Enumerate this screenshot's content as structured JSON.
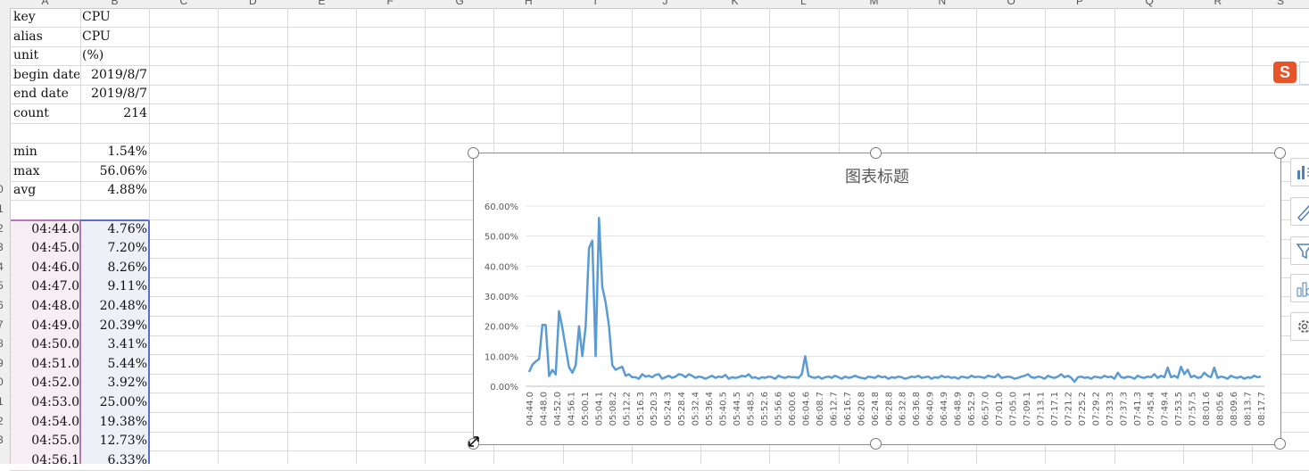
{
  "sheet": {
    "column_letters": [
      "A",
      "B",
      "C",
      "D",
      "E",
      "F",
      "G",
      "H",
      "I",
      "J",
      "K",
      "L",
      "M",
      "N",
      "O",
      "P",
      "Q",
      "R",
      "S"
    ],
    "row_numbers": [
      "",
      "",
      "",
      "",
      "",
      "",
      "",
      "",
      "",
      "0",
      "1",
      "2",
      "3",
      "4",
      "5",
      "6",
      "7",
      "8",
      "9",
      "0",
      "1",
      "2",
      "3",
      ""
    ],
    "info_rows": [
      {
        "label": "key",
        "value": "CPU"
      },
      {
        "label": "alias",
        "value": "CPU"
      },
      {
        "label": "unit",
        "value": "(%)"
      },
      {
        "label": "begin date",
        "value": "2019/8/7"
      },
      {
        "label": "end date",
        "value": "2019/8/7"
      },
      {
        "label": "count",
        "value": "214"
      }
    ],
    "stat_rows": [
      {
        "label": "min",
        "value": "1.54%"
      },
      {
        "label": "max",
        "value": "56.06%"
      },
      {
        "label": "avg",
        "value": "4.88%"
      }
    ],
    "data_rows": [
      {
        "time": "04:44.0",
        "value": "4.76%"
      },
      {
        "time": "04:45.0",
        "value": "7.20%"
      },
      {
        "time": "04:46.0",
        "value": "8.26%"
      },
      {
        "time": "04:47.0",
        "value": "9.11%"
      },
      {
        "time": "04:48.0",
        "value": "20.48%"
      },
      {
        "time": "04:49.0",
        "value": "20.39%"
      },
      {
        "time": "04:50.0",
        "value": "3.41%"
      },
      {
        "time": "04:51.0",
        "value": "5.44%"
      },
      {
        "time": "04:52.0",
        "value": "3.92%"
      },
      {
        "time": "04:53.0",
        "value": "25.00%"
      },
      {
        "time": "04:54.0",
        "value": "19.38%"
      },
      {
        "time": "04:55.0",
        "value": "12.73%"
      },
      {
        "time": "04:56.1",
        "value": "6.33%"
      }
    ]
  },
  "toolbar_icons": [
    "chart-elements-icon",
    "chart-styles-icon",
    "chart-filters-icon",
    "chart-type-icon",
    "chart-settings-icon"
  ],
  "sogou_badge": "S",
  "chart_data": {
    "type": "line",
    "title": "图表标题",
    "color": "#5b9bd5",
    "ylim": [
      0,
      0.6
    ],
    "yticks": [
      "0.00%",
      "10.00%",
      "20.00%",
      "30.00%",
      "40.00%",
      "50.00%",
      "60.00%"
    ],
    "grid": true,
    "legend": "none",
    "x_tick_labels": [
      "04:44.0",
      "04:48.0",
      "04:52.0",
      "04:56.1",
      "05:00.1",
      "05:04.1",
      "05:08.2",
      "05:12.2",
      "05:16.3",
      "05:20.3",
      "05:24.3",
      "05:28.4",
      "05:32.4",
      "05:36.4",
      "05:40.5",
      "05:44.5",
      "05:48.5",
      "05:52.6",
      "05:56.6",
      "06:00.6",
      "06:04.6",
      "06:08.7",
      "06:12.7",
      "06:16.7",
      "06:20.8",
      "06:24.8",
      "06:28.8",
      "06:32.8",
      "06:36.8",
      "06:40.9",
      "06:44.9",
      "06:48.9",
      "06:52.9",
      "06:57.0",
      "07:01.0",
      "07:05.0",
      "07:09.1",
      "07:13.1",
      "07:17.1",
      "07:21.2",
      "07:25.2",
      "07:29.2",
      "07:33.3",
      "07:37.3",
      "07:41.3",
      "07:45.4",
      "07:49.4",
      "07:53.5",
      "07:57.5",
      "08:01.6",
      "08:05.6",
      "08:09.6",
      "08:13.7",
      "08:17.7"
    ],
    "series": [
      {
        "values": [
          0.0476,
          0.072,
          0.0826,
          0.0911,
          0.2048,
          0.2039,
          0.0341,
          0.0544,
          0.0392,
          0.25,
          0.1938,
          0.1273,
          0.0633,
          0.045,
          0.07,
          0.2,
          0.1,
          0.2,
          0.46,
          0.485,
          0.1,
          0.5606,
          0.33,
          0.28,
          0.2,
          0.07,
          0.055,
          0.06,
          0.065,
          0.035,
          0.04,
          0.03,
          0.03,
          0.025,
          0.04,
          0.032,
          0.035,
          0.03,
          0.038,
          0.04,
          0.025,
          0.03,
          0.035,
          0.028,
          0.032,
          0.04,
          0.038,
          0.03,
          0.04,
          0.035,
          0.028,
          0.032,
          0.03,
          0.025,
          0.03,
          0.035,
          0.028,
          0.032,
          0.03,
          0.038,
          0.025,
          0.03,
          0.028,
          0.03,
          0.035,
          0.032,
          0.04,
          0.028,
          0.03,
          0.025,
          0.03,
          0.028,
          0.032,
          0.03,
          0.025,
          0.035,
          0.03,
          0.028,
          0.032,
          0.03,
          0.03,
          0.028,
          0.04,
          0.1,
          0.035,
          0.03,
          0.028,
          0.032,
          0.025,
          0.03,
          0.032,
          0.028,
          0.035,
          0.03,
          0.025,
          0.032,
          0.028,
          0.03,
          0.035,
          0.03,
          0.028,
          0.025,
          0.032,
          0.03,
          0.028,
          0.035,
          0.03,
          0.032,
          0.025,
          0.03,
          0.028,
          0.032,
          0.03,
          0.025,
          0.028,
          0.032,
          0.03,
          0.035,
          0.028,
          0.03,
          0.032,
          0.025,
          0.03,
          0.028,
          0.035,
          0.03,
          0.032,
          0.028,
          0.03,
          0.025,
          0.032,
          0.03,
          0.028,
          0.035,
          0.03,
          0.032,
          0.03,
          0.028,
          0.035,
          0.032,
          0.03,
          0.04,
          0.028,
          0.03,
          0.032,
          0.03,
          0.025,
          0.028,
          0.032,
          0.035,
          0.04,
          0.03,
          0.028,
          0.032,
          0.03,
          0.025,
          0.035,
          0.03,
          0.028,
          0.032,
          0.04,
          0.03,
          0.035,
          0.028,
          0.015,
          0.03,
          0.032,
          0.028,
          0.03,
          0.025,
          0.032,
          0.03,
          0.028,
          0.035,
          0.03,
          0.032,
          0.025,
          0.045,
          0.03,
          0.028,
          0.032,
          0.03,
          0.025,
          0.035,
          0.03,
          0.028,
          0.032,
          0.03,
          0.04,
          0.028,
          0.035,
          0.03,
          0.062,
          0.03,
          0.035,
          0.028,
          0.065,
          0.04,
          0.055,
          0.03,
          0.035,
          0.028,
          0.03,
          0.045,
          0.035,
          0.03,
          0.062,
          0.028,
          0.032,
          0.03,
          0.025,
          0.035,
          0.03,
          0.028,
          0.032,
          0.025,
          0.03,
          0.028,
          0.035,
          0.03,
          0.032
        ]
      }
    ]
  }
}
